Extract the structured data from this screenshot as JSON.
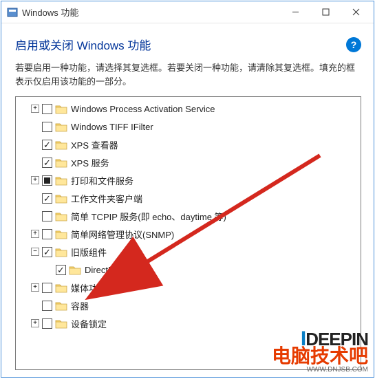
{
  "titlebar": {
    "title": "Windows 功能"
  },
  "heading": "启用或关闭 Windows 功能",
  "help_symbol": "?",
  "description": "若要启用一种功能，请选择其复选框。若要关闭一种功能，请清除其复选框。填充的框表示仅启用该功能的一部分。",
  "tree": [
    {
      "indent": 1,
      "expander": "+",
      "check": "none",
      "label": "Windows Process Activation Service"
    },
    {
      "indent": 1,
      "expander": "",
      "check": "none",
      "label": "Windows TIFF IFilter"
    },
    {
      "indent": 1,
      "expander": "",
      "check": "checked",
      "label": "XPS 查看器"
    },
    {
      "indent": 1,
      "expander": "",
      "check": "checked",
      "label": "XPS 服务"
    },
    {
      "indent": 1,
      "expander": "+",
      "check": "mixed",
      "label": "打印和文件服务"
    },
    {
      "indent": 1,
      "expander": "",
      "check": "checked",
      "label": "工作文件夹客户端"
    },
    {
      "indent": 1,
      "expander": "",
      "check": "none",
      "label": "简单 TCPIP 服务(即 echo、daytime 等)"
    },
    {
      "indent": 1,
      "expander": "+",
      "check": "none",
      "label": "简单网络管理协议(SNMP)"
    },
    {
      "indent": 1,
      "expander": "-",
      "check": "checked",
      "label": "旧版组件"
    },
    {
      "indent": 2,
      "expander": "",
      "check": "checked",
      "label": "DirectPlay"
    },
    {
      "indent": 1,
      "expander": "+",
      "check": "none",
      "label": "媒体功能"
    },
    {
      "indent": 1,
      "expander": "",
      "check": "none",
      "label": "容器"
    },
    {
      "indent": 1,
      "expander": "+",
      "check": "none",
      "label": "设备锁定"
    }
  ],
  "watermark": {
    "brand_prefix": "I",
    "brand_rest": "DEEPIN",
    "cn": "电脑技术吧",
    "sub": "WWW.DNJSB.COM"
  }
}
